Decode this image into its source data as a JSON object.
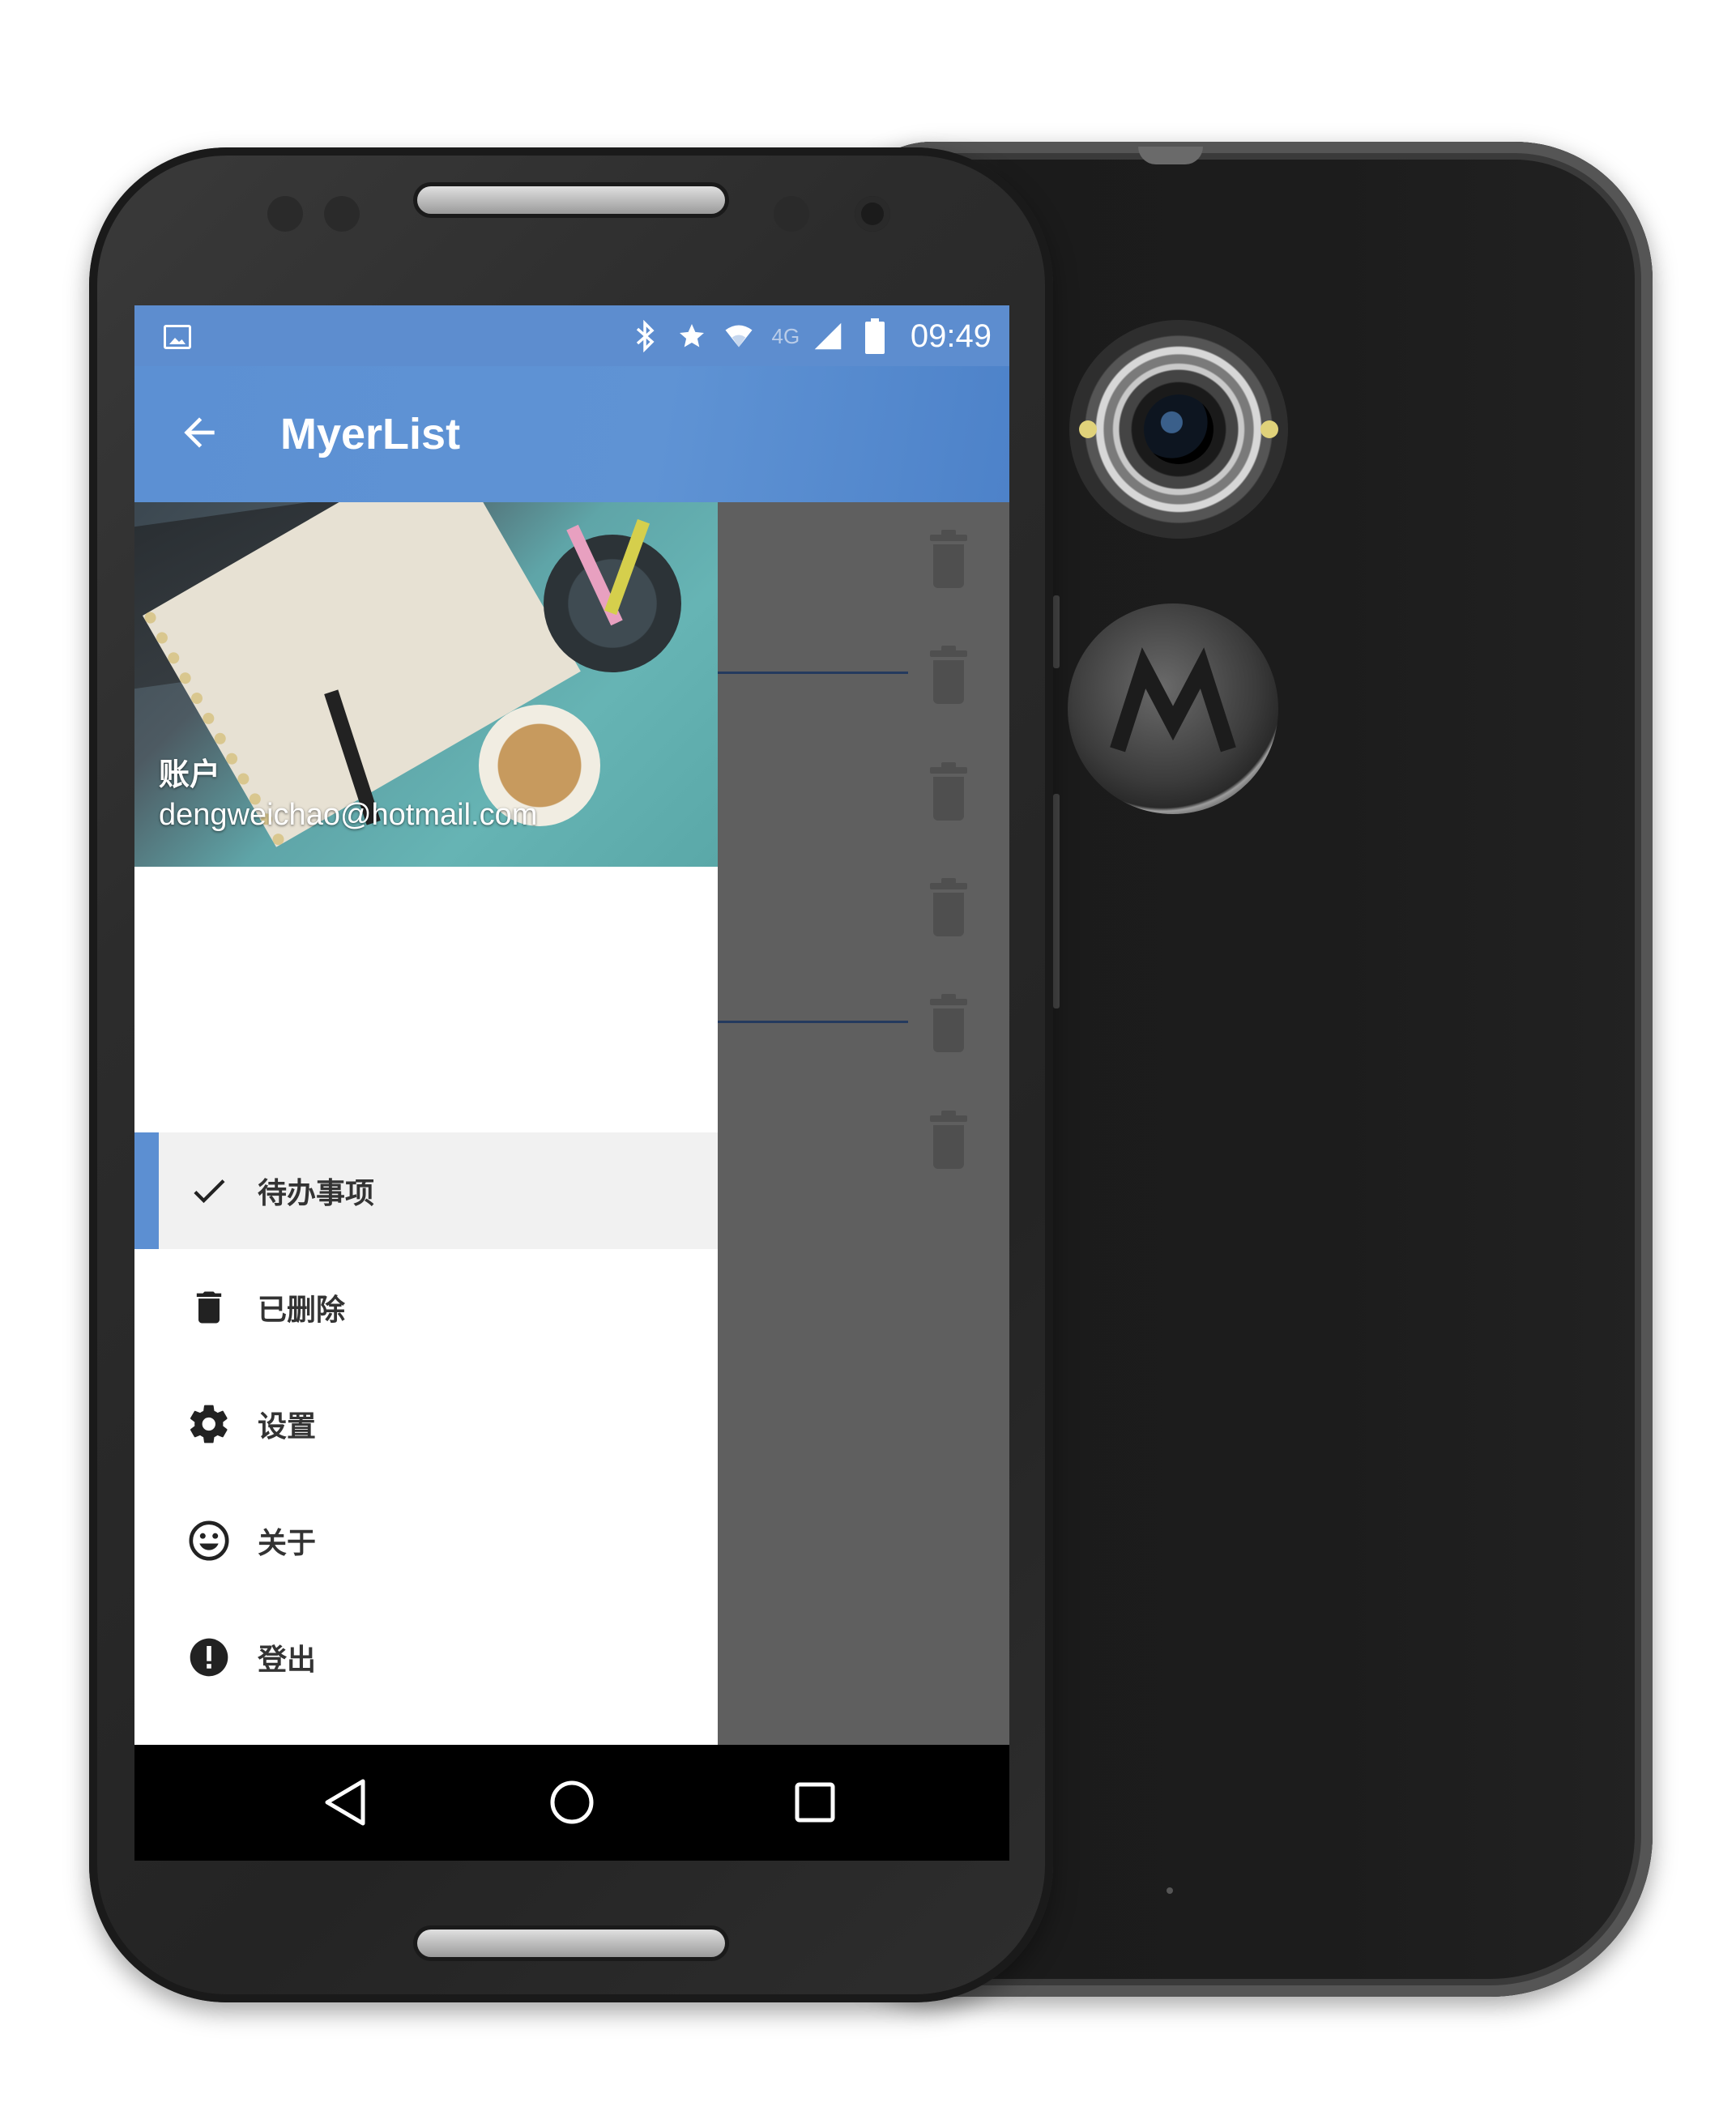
{
  "status_bar": {
    "network_label": "4G",
    "time": "09:49",
    "icons": [
      "image-icon",
      "bluetooth-icon",
      "star-icon",
      "wifi-icon",
      "signal-icon",
      "battery-icon"
    ]
  },
  "app_bar": {
    "title": "MyerList",
    "back_icon": "arrow-left-icon"
  },
  "drawer": {
    "account_label": "账户",
    "account_email": "dengweichao@hotmail.com",
    "menu": [
      {
        "label": "待办事项",
        "icon": "check-icon",
        "active": true
      },
      {
        "label": "已删除",
        "icon": "trash-icon",
        "active": false
      },
      {
        "label": "设置",
        "icon": "gear-icon",
        "active": false
      },
      {
        "label": "关于",
        "icon": "smiley-icon",
        "active": false
      },
      {
        "label": "登出",
        "icon": "alert-icon",
        "active": false
      }
    ]
  },
  "fab": {
    "label": "+"
  },
  "colors": {
    "accent": "#5c8fd2",
    "fab": "#6c1530",
    "scrim": "#5f5f5f"
  }
}
